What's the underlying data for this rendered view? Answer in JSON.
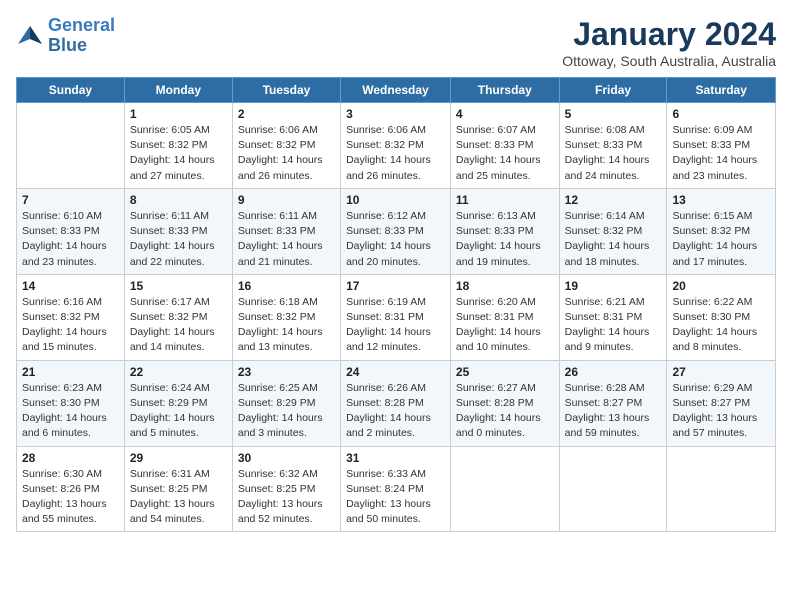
{
  "logo": {
    "line1": "General",
    "line2": "Blue"
  },
  "title": "January 2024",
  "subtitle": "Ottoway, South Australia, Australia",
  "weekdays": [
    "Sunday",
    "Monday",
    "Tuesday",
    "Wednesday",
    "Thursday",
    "Friday",
    "Saturday"
  ],
  "weeks": [
    [
      {
        "day": "",
        "sunrise": "",
        "sunset": "",
        "daylight": ""
      },
      {
        "day": "1",
        "sunrise": "Sunrise: 6:05 AM",
        "sunset": "Sunset: 8:32 PM",
        "daylight": "Daylight: 14 hours and 27 minutes."
      },
      {
        "day": "2",
        "sunrise": "Sunrise: 6:06 AM",
        "sunset": "Sunset: 8:32 PM",
        "daylight": "Daylight: 14 hours and 26 minutes."
      },
      {
        "day": "3",
        "sunrise": "Sunrise: 6:06 AM",
        "sunset": "Sunset: 8:32 PM",
        "daylight": "Daylight: 14 hours and 26 minutes."
      },
      {
        "day": "4",
        "sunrise": "Sunrise: 6:07 AM",
        "sunset": "Sunset: 8:33 PM",
        "daylight": "Daylight: 14 hours and 25 minutes."
      },
      {
        "day": "5",
        "sunrise": "Sunrise: 6:08 AM",
        "sunset": "Sunset: 8:33 PM",
        "daylight": "Daylight: 14 hours and 24 minutes."
      },
      {
        "day": "6",
        "sunrise": "Sunrise: 6:09 AM",
        "sunset": "Sunset: 8:33 PM",
        "daylight": "Daylight: 14 hours and 23 minutes."
      }
    ],
    [
      {
        "day": "7",
        "sunrise": "Sunrise: 6:10 AM",
        "sunset": "Sunset: 8:33 PM",
        "daylight": "Daylight: 14 hours and 23 minutes."
      },
      {
        "day": "8",
        "sunrise": "Sunrise: 6:11 AM",
        "sunset": "Sunset: 8:33 PM",
        "daylight": "Daylight: 14 hours and 22 minutes."
      },
      {
        "day": "9",
        "sunrise": "Sunrise: 6:11 AM",
        "sunset": "Sunset: 8:33 PM",
        "daylight": "Daylight: 14 hours and 21 minutes."
      },
      {
        "day": "10",
        "sunrise": "Sunrise: 6:12 AM",
        "sunset": "Sunset: 8:33 PM",
        "daylight": "Daylight: 14 hours and 20 minutes."
      },
      {
        "day": "11",
        "sunrise": "Sunrise: 6:13 AM",
        "sunset": "Sunset: 8:33 PM",
        "daylight": "Daylight: 14 hours and 19 minutes."
      },
      {
        "day": "12",
        "sunrise": "Sunrise: 6:14 AM",
        "sunset": "Sunset: 8:32 PM",
        "daylight": "Daylight: 14 hours and 18 minutes."
      },
      {
        "day": "13",
        "sunrise": "Sunrise: 6:15 AM",
        "sunset": "Sunset: 8:32 PM",
        "daylight": "Daylight: 14 hours and 17 minutes."
      }
    ],
    [
      {
        "day": "14",
        "sunrise": "Sunrise: 6:16 AM",
        "sunset": "Sunset: 8:32 PM",
        "daylight": "Daylight: 14 hours and 15 minutes."
      },
      {
        "day": "15",
        "sunrise": "Sunrise: 6:17 AM",
        "sunset": "Sunset: 8:32 PM",
        "daylight": "Daylight: 14 hours and 14 minutes."
      },
      {
        "day": "16",
        "sunrise": "Sunrise: 6:18 AM",
        "sunset": "Sunset: 8:32 PM",
        "daylight": "Daylight: 14 hours and 13 minutes."
      },
      {
        "day": "17",
        "sunrise": "Sunrise: 6:19 AM",
        "sunset": "Sunset: 8:31 PM",
        "daylight": "Daylight: 14 hours and 12 minutes."
      },
      {
        "day": "18",
        "sunrise": "Sunrise: 6:20 AM",
        "sunset": "Sunset: 8:31 PM",
        "daylight": "Daylight: 14 hours and 10 minutes."
      },
      {
        "day": "19",
        "sunrise": "Sunrise: 6:21 AM",
        "sunset": "Sunset: 8:31 PM",
        "daylight": "Daylight: 14 hours and 9 minutes."
      },
      {
        "day": "20",
        "sunrise": "Sunrise: 6:22 AM",
        "sunset": "Sunset: 8:30 PM",
        "daylight": "Daylight: 14 hours and 8 minutes."
      }
    ],
    [
      {
        "day": "21",
        "sunrise": "Sunrise: 6:23 AM",
        "sunset": "Sunset: 8:30 PM",
        "daylight": "Daylight: 14 hours and 6 minutes."
      },
      {
        "day": "22",
        "sunrise": "Sunrise: 6:24 AM",
        "sunset": "Sunset: 8:29 PM",
        "daylight": "Daylight: 14 hours and 5 minutes."
      },
      {
        "day": "23",
        "sunrise": "Sunrise: 6:25 AM",
        "sunset": "Sunset: 8:29 PM",
        "daylight": "Daylight: 14 hours and 3 minutes."
      },
      {
        "day": "24",
        "sunrise": "Sunrise: 6:26 AM",
        "sunset": "Sunset: 8:28 PM",
        "daylight": "Daylight: 14 hours and 2 minutes."
      },
      {
        "day": "25",
        "sunrise": "Sunrise: 6:27 AM",
        "sunset": "Sunset: 8:28 PM",
        "daylight": "Daylight: 14 hours and 0 minutes."
      },
      {
        "day": "26",
        "sunrise": "Sunrise: 6:28 AM",
        "sunset": "Sunset: 8:27 PM",
        "daylight": "Daylight: 13 hours and 59 minutes."
      },
      {
        "day": "27",
        "sunrise": "Sunrise: 6:29 AM",
        "sunset": "Sunset: 8:27 PM",
        "daylight": "Daylight: 13 hours and 57 minutes."
      }
    ],
    [
      {
        "day": "28",
        "sunrise": "Sunrise: 6:30 AM",
        "sunset": "Sunset: 8:26 PM",
        "daylight": "Daylight: 13 hours and 55 minutes."
      },
      {
        "day": "29",
        "sunrise": "Sunrise: 6:31 AM",
        "sunset": "Sunset: 8:25 PM",
        "daylight": "Daylight: 13 hours and 54 minutes."
      },
      {
        "day": "30",
        "sunrise": "Sunrise: 6:32 AM",
        "sunset": "Sunset: 8:25 PM",
        "daylight": "Daylight: 13 hours and 52 minutes."
      },
      {
        "day": "31",
        "sunrise": "Sunrise: 6:33 AM",
        "sunset": "Sunset: 8:24 PM",
        "daylight": "Daylight: 13 hours and 50 minutes."
      },
      {
        "day": "",
        "sunrise": "",
        "sunset": "",
        "daylight": ""
      },
      {
        "day": "",
        "sunrise": "",
        "sunset": "",
        "daylight": ""
      },
      {
        "day": "",
        "sunrise": "",
        "sunset": "",
        "daylight": ""
      }
    ]
  ]
}
